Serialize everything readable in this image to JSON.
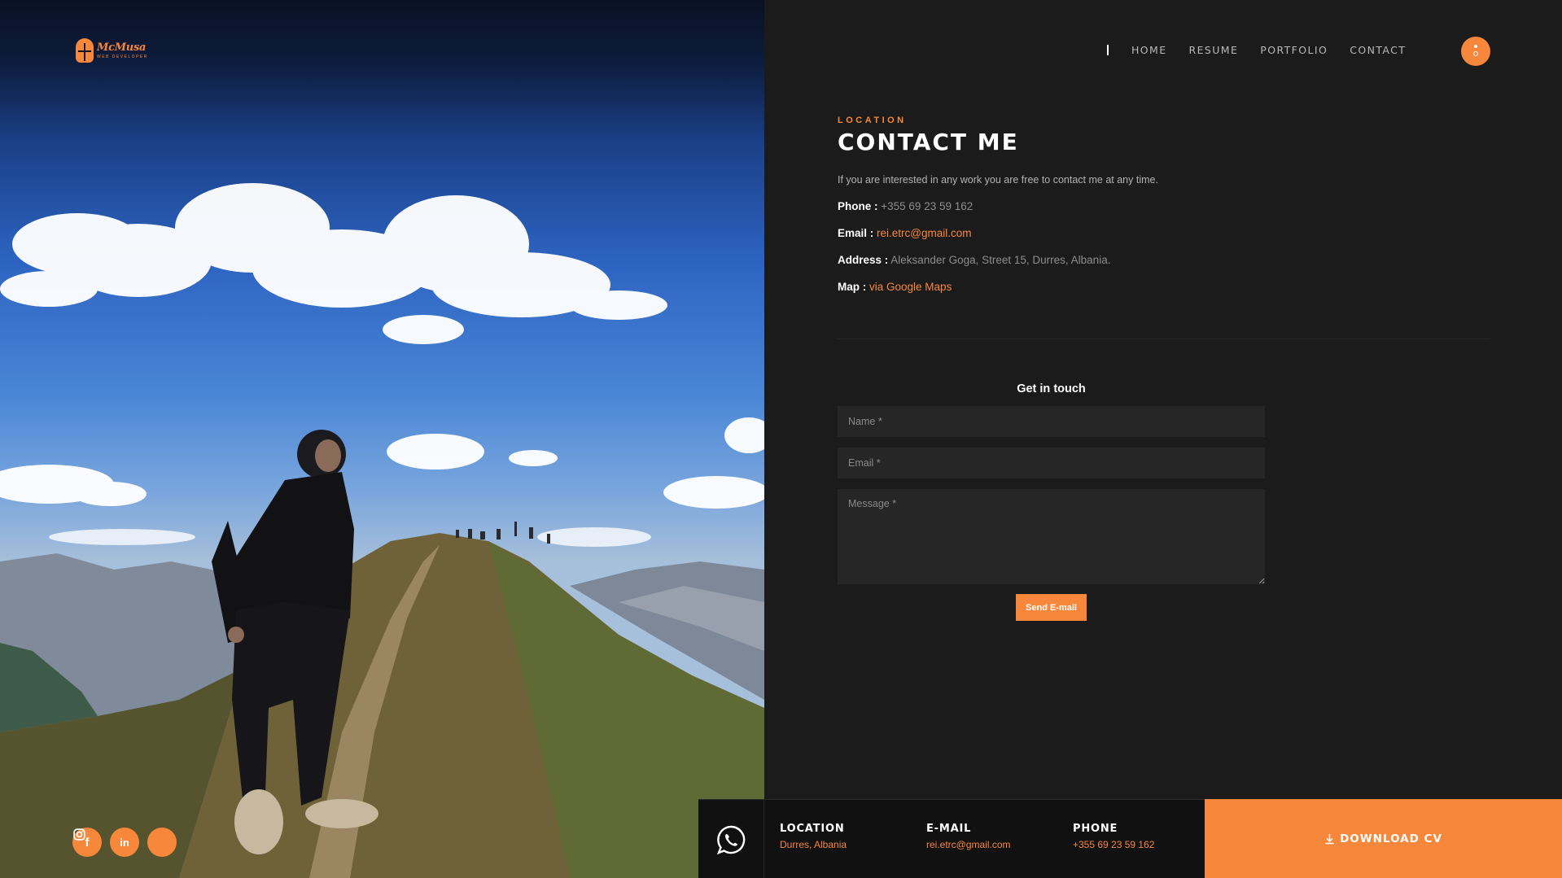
{
  "brand": {
    "name": "McMusa",
    "tagline": "WEB DEVELOPER"
  },
  "nav": {
    "items": [
      {
        "label": "HOME"
      },
      {
        "label": "RESUME"
      },
      {
        "label": "PORTFOLIO"
      },
      {
        "label": "CONTACT"
      }
    ]
  },
  "contact": {
    "eyebrow": "LOCATION",
    "title": "CONTACT ME",
    "intro": "If you are interested in any work you are free to contact me at any time.",
    "phone": {
      "label": "Phone :",
      "value": "+355 69 23 59 162"
    },
    "email": {
      "label": "Email :",
      "value": "rei.etrc@gmail.com"
    },
    "address": {
      "label": "Address :",
      "value": "Aleksander Goga, Street 15, Durres, Albania."
    },
    "map": {
      "label": "Map :",
      "value": "via Google Maps"
    }
  },
  "form": {
    "title": "Get in touch",
    "name_placeholder": "Name *",
    "email_placeholder": "Email *",
    "message_placeholder": "Message *",
    "submit_label": "Send E-mail"
  },
  "footer": {
    "location": {
      "label": "LOCATION",
      "value": "Durres, Albania"
    },
    "email": {
      "label": "E-MAIL",
      "value": "rei.etrc@gmail.com"
    },
    "phone": {
      "label": "PHONE",
      "value": "+355 69 23 59 162"
    },
    "download_label": "DOWNLOAD CV"
  },
  "socials": [
    {
      "icon": "facebook-icon",
      "glyph": "f"
    },
    {
      "icon": "linkedin-icon",
      "glyph": "in"
    },
    {
      "icon": "instagram-icon",
      "glyph": ""
    }
  ],
  "colors": {
    "accent": "#f7873a",
    "background": "#1b1b1b",
    "footer": "#111111",
    "field": "#262626"
  }
}
